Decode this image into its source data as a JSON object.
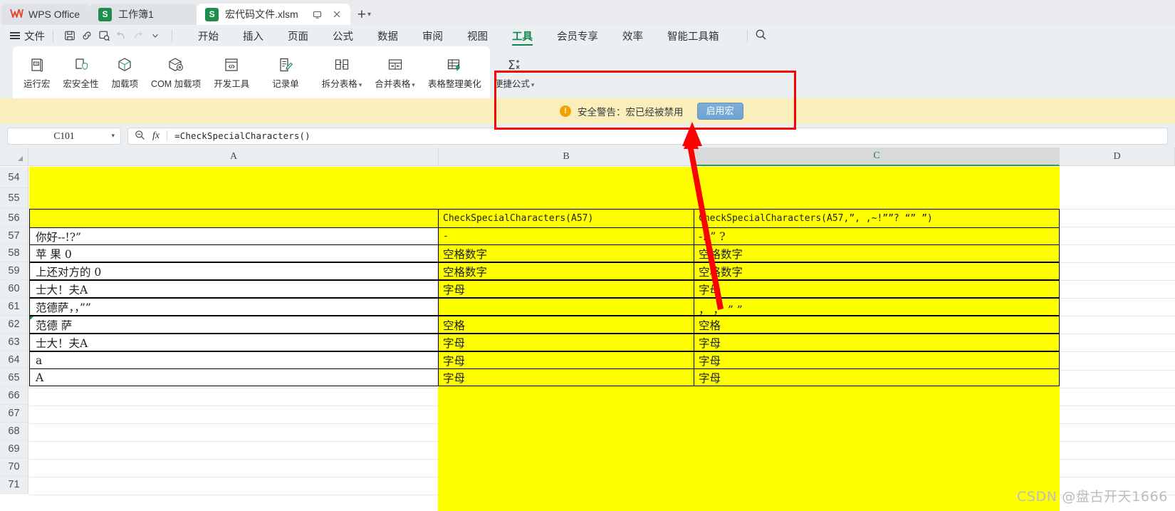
{
  "window": {
    "brand": "WPS Office",
    "tabs": [
      {
        "label": "工作簿1",
        "icon": "sheet-icon",
        "active": false
      },
      {
        "label": "宏代码文件.xlsm",
        "icon": "sheet-icon",
        "active": true
      }
    ],
    "tab_restore_icon": "restore-window-icon",
    "tab_close_icon": "close-icon",
    "new_tab_icon": "plus-icon",
    "new_tab_chevron_icon": "chevron-down-icon"
  },
  "menubar": {
    "file_label": "文件",
    "quick_access": [
      "save-icon",
      "link-icon",
      "print-preview-icon",
      "undo-icon",
      "redo-icon",
      "chevron-down-icon"
    ],
    "tabs": [
      {
        "label": "开始",
        "active": false
      },
      {
        "label": "插入",
        "active": false
      },
      {
        "label": "页面",
        "active": false
      },
      {
        "label": "公式",
        "active": false
      },
      {
        "label": "数据",
        "active": false
      },
      {
        "label": "审阅",
        "active": false
      },
      {
        "label": "视图",
        "active": false
      },
      {
        "label": "工具",
        "active": true
      },
      {
        "label": "会员专享",
        "active": false
      },
      {
        "label": "效率",
        "active": false
      },
      {
        "label": "智能工具箱",
        "active": false
      }
    ],
    "search_icon": "search-icon"
  },
  "ribbon": {
    "groups": [
      {
        "buttons": [
          {
            "label": "运行宏",
            "icon": "run-macro-icon",
            "dropdown": false
          },
          {
            "label": "宏安全性",
            "icon": "macro-security-icon",
            "dropdown": false
          },
          {
            "label": "加载项",
            "icon": "addin-icon",
            "dropdown": false
          },
          {
            "label": "COM 加载项",
            "icon": "com-addin-icon",
            "dropdown": false
          },
          {
            "label": "开发工具",
            "icon": "dev-tools-icon",
            "dropdown": false
          }
        ]
      },
      {
        "buttons": [
          {
            "label": "记录单",
            "icon": "record-form-icon",
            "dropdown": false
          }
        ]
      },
      {
        "buttons": [
          {
            "label": "拆分表格",
            "icon": "split-table-icon",
            "dropdown": true
          },
          {
            "label": "合并表格",
            "icon": "merge-table-icon",
            "dropdown": true
          },
          {
            "label": "表格整理美化",
            "icon": "beautify-table-icon",
            "dropdown": false
          },
          {
            "label": "便捷公式",
            "icon": "quick-formula-icon",
            "dropdown": true
          }
        ]
      }
    ]
  },
  "warning": {
    "icon": "alert-icon",
    "icon_glyph": "!",
    "text": "安全警告：宏已经被禁用",
    "button_label": "启用宏",
    "bg_color": "#fbeebd",
    "button_color": "#6ea4d1"
  },
  "formula_bar": {
    "name_box_value": "C101",
    "name_box_chevron_icon": "chevron-down-icon",
    "zoom_icon": "zoom-out-icon",
    "fx_icon": "fx",
    "formula": "=CheckSpecialCharacters()"
  },
  "grid": {
    "columns": [
      {
        "label": "A",
        "selected": false
      },
      {
        "label": "B",
        "selected": false
      },
      {
        "label": "C",
        "selected": true
      },
      {
        "label": "D",
        "selected": false
      }
    ],
    "rows": [
      "54",
      "55",
      "56",
      "57",
      "58",
      "59",
      "60",
      "61",
      "62",
      "63",
      "64",
      "65",
      "66",
      "67",
      "68",
      "69",
      "70",
      "71"
    ],
    "cells": {
      "A56": "",
      "B56": "CheckSpecialCharacters(A57)",
      "C56": "CheckSpecialCharacters(A57,”, ,~!””? “” ”)",
      "A57": "你好--!?”",
      "B57": "-",
      "C57": "-!  ”  ?",
      "A58": "苹 果 0",
      "B58": "空格数字",
      "C58": "空格数字",
      "A59": "上还对方的 0",
      "B59": "空格数字",
      "C59": "空格数字",
      "A60": "士大！夫A",
      "B60": "字母",
      "C60": "字母",
      "A61": "范德萨，，””",
      "B61": "",
      "C61": "，  ，   ”   ”",
      "A62": "范德 萨",
      "B62": "空格",
      "C62": "空格",
      "A63": "士大！夫A",
      "B63": "字母",
      "C63": "字母",
      "A64": "a",
      "B64": "字母",
      "C64": "字母",
      "A65": "A",
      "B65": "字母",
      "C65": "字母"
    },
    "highlight_color": "#ffff00"
  },
  "annotations": {
    "rect_color": "#fe0000",
    "arrow_color": "#fe0000",
    "arrow_target": "启用宏"
  },
  "watermark": {
    "text": "CSDN @盘古开天1666"
  }
}
